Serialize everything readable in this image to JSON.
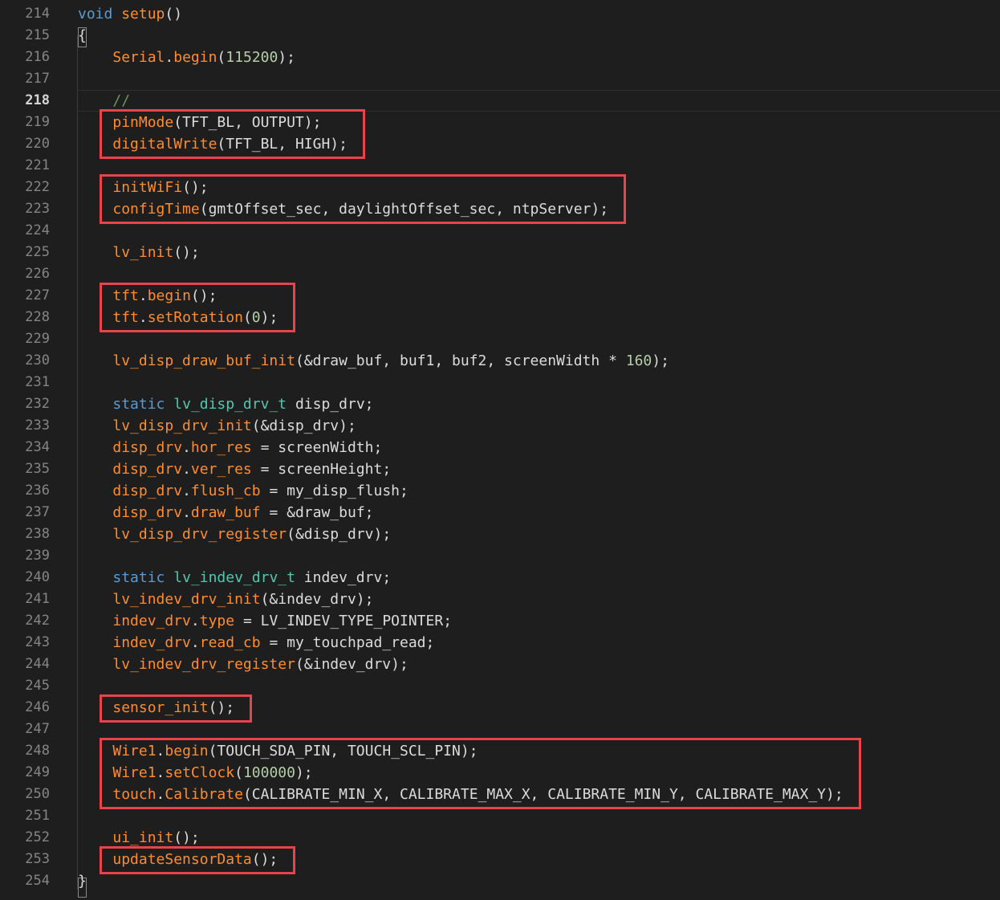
{
  "editor": {
    "current_line": 218,
    "gutter": {
      "line_numbers": [
        "214",
        "215",
        "216",
        "217",
        "218",
        "219",
        "220",
        "221",
        "222",
        "223",
        "224",
        "225",
        "226",
        "227",
        "228",
        "229",
        "230",
        "231",
        "232",
        "233",
        "234",
        "235",
        "236",
        "237",
        "238",
        "239",
        "240",
        "241",
        "242",
        "243",
        "244",
        "245",
        "246",
        "247",
        "248",
        "249",
        "250",
        "251",
        "252",
        "253",
        "254"
      ]
    },
    "code_lines": [
      [
        {
          "t": "void",
          "c": "kw"
        },
        {
          "t": " ",
          "c": "tx"
        },
        {
          "t": "setup",
          "c": "fn"
        },
        {
          "t": "()",
          "c": "tx"
        }
      ],
      [
        {
          "t": "{",
          "c": "tx"
        }
      ],
      [
        {
          "t": "    ",
          "c": "tx"
        },
        {
          "t": "Serial",
          "c": "fn"
        },
        {
          "t": ".",
          "c": "tx"
        },
        {
          "t": "begin",
          "c": "fn"
        },
        {
          "t": "(",
          "c": "tx"
        },
        {
          "t": "115200",
          "c": "num"
        },
        {
          "t": ");",
          "c": "tx"
        }
      ],
      [],
      [
        {
          "t": "    ",
          "c": "tx"
        },
        {
          "t": "//",
          "c": "cm"
        }
      ],
      [
        {
          "t": "    ",
          "c": "tx"
        },
        {
          "t": "pinMode",
          "c": "fn"
        },
        {
          "t": "(TFT_BL, OUTPUT);",
          "c": "tx"
        }
      ],
      [
        {
          "t": "    ",
          "c": "tx"
        },
        {
          "t": "digitalWrite",
          "c": "fn"
        },
        {
          "t": "(TFT_BL, HIGH);",
          "c": "tx"
        }
      ],
      [],
      [
        {
          "t": "    ",
          "c": "tx"
        },
        {
          "t": "initWiFi",
          "c": "fn"
        },
        {
          "t": "();",
          "c": "tx"
        }
      ],
      [
        {
          "t": "    ",
          "c": "tx"
        },
        {
          "t": "configTime",
          "c": "fn"
        },
        {
          "t": "(gmtOffset_sec, daylightOffset_sec, ntpServer);",
          "c": "tx"
        }
      ],
      [],
      [
        {
          "t": "    ",
          "c": "tx"
        },
        {
          "t": "lv_init",
          "c": "fn"
        },
        {
          "t": "();",
          "c": "tx"
        }
      ],
      [],
      [
        {
          "t": "    ",
          "c": "tx"
        },
        {
          "t": "tft",
          "c": "fn"
        },
        {
          "t": ".",
          "c": "tx"
        },
        {
          "t": "begin",
          "c": "fn"
        },
        {
          "t": "();",
          "c": "tx"
        }
      ],
      [
        {
          "t": "    ",
          "c": "tx"
        },
        {
          "t": "tft",
          "c": "fn"
        },
        {
          "t": ".",
          "c": "tx"
        },
        {
          "t": "setRotation",
          "c": "fn"
        },
        {
          "t": "(",
          "c": "tx"
        },
        {
          "t": "0",
          "c": "num"
        },
        {
          "t": ");",
          "c": "tx"
        }
      ],
      [],
      [
        {
          "t": "    ",
          "c": "tx"
        },
        {
          "t": "lv_disp_draw_buf_init",
          "c": "fn"
        },
        {
          "t": "(&draw_buf, buf1, buf2, screenWidth * ",
          "c": "tx"
        },
        {
          "t": "160",
          "c": "num"
        },
        {
          "t": ");",
          "c": "tx"
        }
      ],
      [],
      [
        {
          "t": "    ",
          "c": "tx"
        },
        {
          "t": "static",
          "c": "kw"
        },
        {
          "t": " ",
          "c": "tx"
        },
        {
          "t": "lv_disp_drv_t",
          "c": "ty"
        },
        {
          "t": " disp_drv;",
          "c": "tx"
        }
      ],
      [
        {
          "t": "    ",
          "c": "tx"
        },
        {
          "t": "lv_disp_drv_init",
          "c": "fn"
        },
        {
          "t": "(&disp_drv);",
          "c": "tx"
        }
      ],
      [
        {
          "t": "    ",
          "c": "tx"
        },
        {
          "t": "disp_drv",
          "c": "fn"
        },
        {
          "t": ".",
          "c": "tx"
        },
        {
          "t": "hor_res",
          "c": "fn"
        },
        {
          "t": " = screenWidth;",
          "c": "tx"
        }
      ],
      [
        {
          "t": "    ",
          "c": "tx"
        },
        {
          "t": "disp_drv",
          "c": "fn"
        },
        {
          "t": ".",
          "c": "tx"
        },
        {
          "t": "ver_res",
          "c": "fn"
        },
        {
          "t": " = screenHeight;",
          "c": "tx"
        }
      ],
      [
        {
          "t": "    ",
          "c": "tx"
        },
        {
          "t": "disp_drv",
          "c": "fn"
        },
        {
          "t": ".",
          "c": "tx"
        },
        {
          "t": "flush_cb",
          "c": "fn"
        },
        {
          "t": " = my_disp_flush;",
          "c": "tx"
        }
      ],
      [
        {
          "t": "    ",
          "c": "tx"
        },
        {
          "t": "disp_drv",
          "c": "fn"
        },
        {
          "t": ".",
          "c": "tx"
        },
        {
          "t": "draw_buf",
          "c": "fn"
        },
        {
          "t": " = &draw_buf;",
          "c": "tx"
        }
      ],
      [
        {
          "t": "    ",
          "c": "tx"
        },
        {
          "t": "lv_disp_drv_register",
          "c": "fn"
        },
        {
          "t": "(&disp_drv);",
          "c": "tx"
        }
      ],
      [],
      [
        {
          "t": "    ",
          "c": "tx"
        },
        {
          "t": "static",
          "c": "kw"
        },
        {
          "t": " ",
          "c": "tx"
        },
        {
          "t": "lv_indev_drv_t",
          "c": "ty"
        },
        {
          "t": " indev_drv;",
          "c": "tx"
        }
      ],
      [
        {
          "t": "    ",
          "c": "tx"
        },
        {
          "t": "lv_indev_drv_init",
          "c": "fn"
        },
        {
          "t": "(&indev_drv);",
          "c": "tx"
        }
      ],
      [
        {
          "t": "    ",
          "c": "tx"
        },
        {
          "t": "indev_drv",
          "c": "fn"
        },
        {
          "t": ".",
          "c": "tx"
        },
        {
          "t": "type",
          "c": "fn"
        },
        {
          "t": " = LV_INDEV_TYPE_POINTER;",
          "c": "tx"
        }
      ],
      [
        {
          "t": "    ",
          "c": "tx"
        },
        {
          "t": "indev_drv",
          "c": "fn"
        },
        {
          "t": ".",
          "c": "tx"
        },
        {
          "t": "read_cb",
          "c": "fn"
        },
        {
          "t": " = my_touchpad_read;",
          "c": "tx"
        }
      ],
      [
        {
          "t": "    ",
          "c": "tx"
        },
        {
          "t": "lv_indev_drv_register",
          "c": "fn"
        },
        {
          "t": "(&indev_drv);",
          "c": "tx"
        }
      ],
      [],
      [
        {
          "t": "    ",
          "c": "tx"
        },
        {
          "t": "sensor_init",
          "c": "fn"
        },
        {
          "t": "();",
          "c": "tx"
        }
      ],
      [],
      [
        {
          "t": "    ",
          "c": "tx"
        },
        {
          "t": "Wire1",
          "c": "fn"
        },
        {
          "t": ".",
          "c": "tx"
        },
        {
          "t": "begin",
          "c": "fn"
        },
        {
          "t": "(TOUCH_SDA_PIN, TOUCH_SCL_PIN);",
          "c": "tx"
        }
      ],
      [
        {
          "t": "    ",
          "c": "tx"
        },
        {
          "t": "Wire1",
          "c": "fn"
        },
        {
          "t": ".",
          "c": "tx"
        },
        {
          "t": "setClock",
          "c": "fn"
        },
        {
          "t": "(",
          "c": "tx"
        },
        {
          "t": "100000",
          "c": "num"
        },
        {
          "t": ");",
          "c": "tx"
        }
      ],
      [
        {
          "t": "    ",
          "c": "tx"
        },
        {
          "t": "touch",
          "c": "fn"
        },
        {
          "t": ".",
          "c": "tx"
        },
        {
          "t": "Calibrate",
          "c": "fn"
        },
        {
          "t": "(CALIBRATE_MIN_X, CALIBRATE_MAX_X, CALIBRATE_MIN_Y, CALIBRATE_MAX_Y);",
          "c": "tx"
        }
      ],
      [],
      [
        {
          "t": "    ",
          "c": "tx"
        },
        {
          "t": "ui_init",
          "c": "fn"
        },
        {
          "t": "();",
          "c": "tx"
        }
      ],
      [
        {
          "t": "    ",
          "c": "tx"
        },
        {
          "t": "updateSensorData",
          "c": "fn"
        },
        {
          "t": "();",
          "c": "tx"
        }
      ],
      [
        {
          "t": "}",
          "c": "tx"
        }
      ]
    ],
    "highlight_boxes": [
      {
        "name": "highlight-pinmode-digitalwrite",
        "first_line": 219,
        "last_line": 220
      },
      {
        "name": "highlight-wifi-configtime",
        "first_line": 222,
        "last_line": 223
      },
      {
        "name": "highlight-tft-init",
        "first_line": 227,
        "last_line": 228
      },
      {
        "name": "highlight-sensor-init",
        "first_line": 246,
        "last_line": 246
      },
      {
        "name": "highlight-wire-touch",
        "first_line": 248,
        "last_line": 250
      },
      {
        "name": "highlight-update-sensor-data",
        "first_line": 253,
        "last_line": 253
      }
    ],
    "colors": {
      "background": "#1e1e1e",
      "keyword": "#569cd6",
      "function": "#ff8c2e",
      "type": "#4ec9b0",
      "number": "#b5cea8",
      "comment": "#6a9955",
      "text": "#dcdcdc",
      "line_number": "#858585",
      "highlight_box": "#e8434a"
    }
  }
}
